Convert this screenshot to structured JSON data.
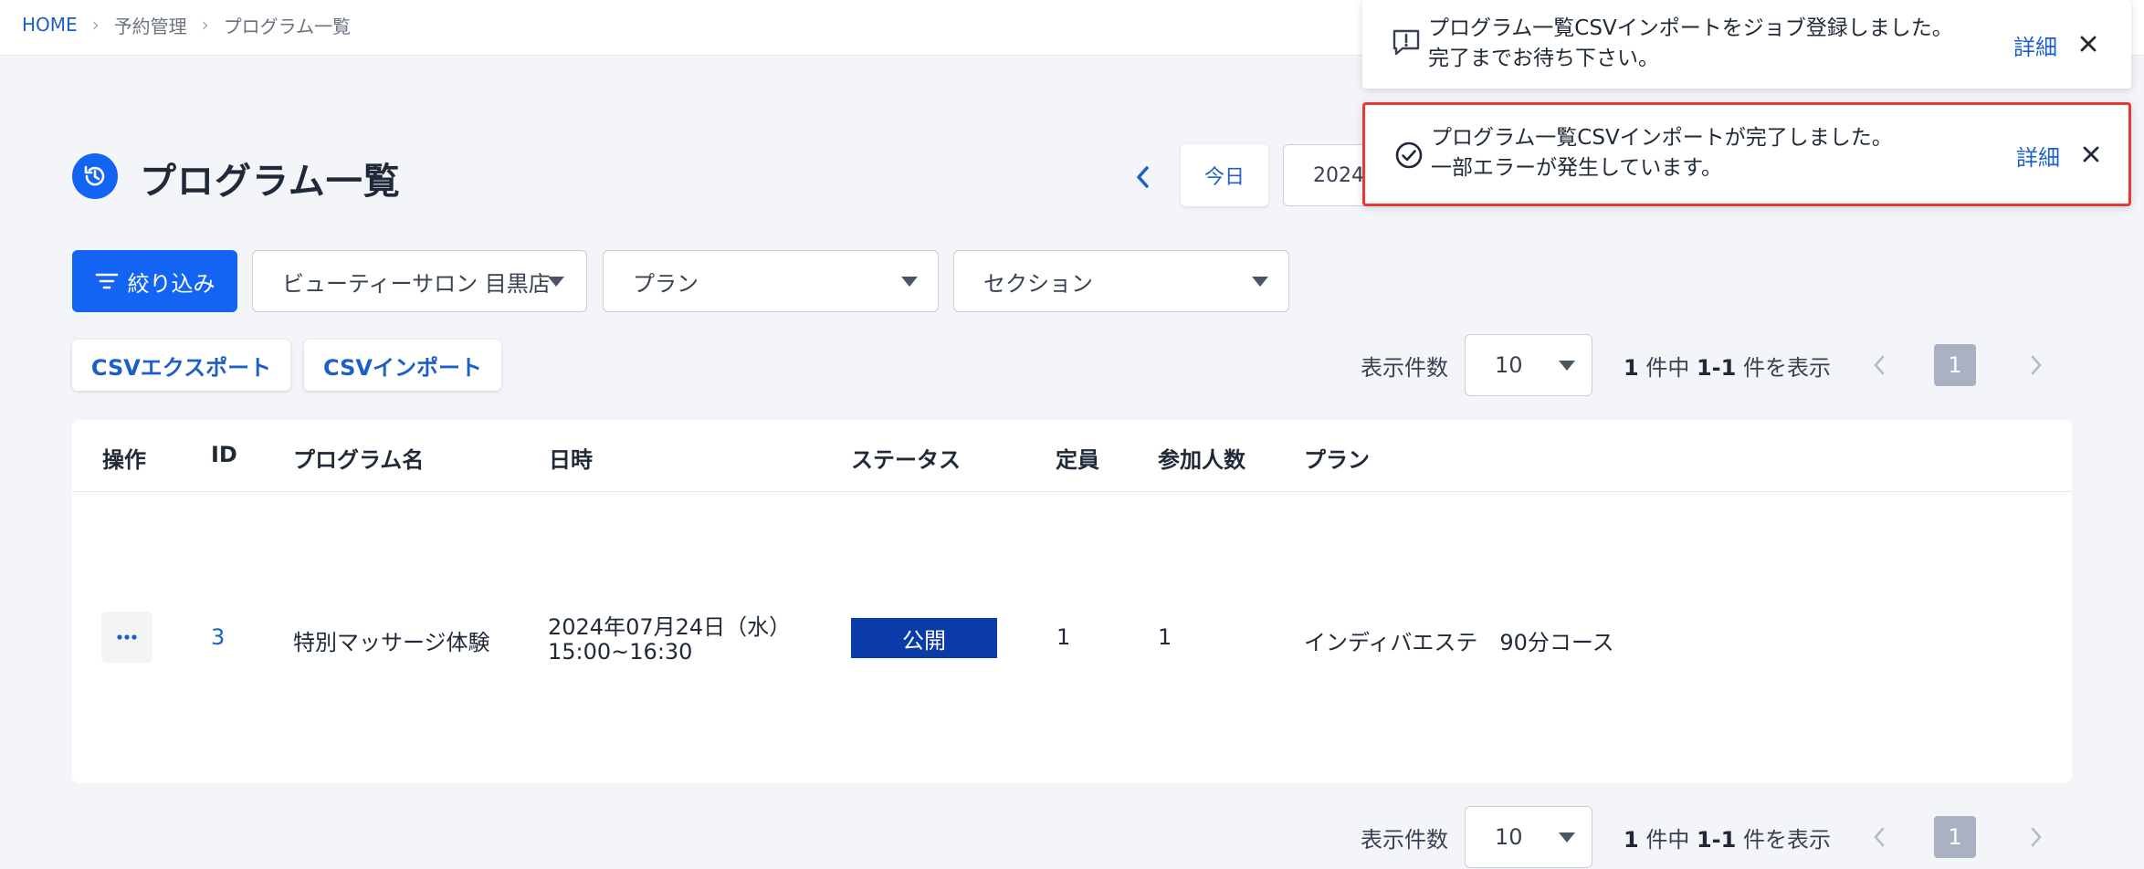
{
  "breadcrumb": {
    "home": "HOME",
    "level2": "予約管理",
    "level3": "プログラム一覧"
  },
  "page": {
    "title": "プログラム一覧"
  },
  "date_nav": {
    "today_label": "今日",
    "date_value": "2024"
  },
  "filters": {
    "filter_button": "絞り込み",
    "store_select": "ビューティーサロン 目黒店",
    "plan_select": "プラン",
    "section_select": "セクション"
  },
  "csv": {
    "export_label": "CSVエクスポート",
    "import_label": "CSVインポート"
  },
  "pagination": {
    "per_page_label": "表示件数",
    "per_page_value": "10",
    "total": "1",
    "unit_total": " 件中 ",
    "range": "1-1",
    "unit_range": " 件を表示",
    "current_page": "1"
  },
  "table": {
    "headers": {
      "action": "操作",
      "id": "ID",
      "name": "プログラム名",
      "datetime": "日時",
      "status": "ステータス",
      "capacity": "定員",
      "participants": "参加人数",
      "plan": "プラン"
    },
    "rows": [
      {
        "id": "3",
        "name": "特別マッサージ体験",
        "date": "2024年07月24日（水）",
        "time": "15:00~16:30",
        "status": "公開",
        "capacity": "1",
        "participants": "1",
        "plan": "インディバエステ　90分コース"
      }
    ]
  },
  "toasts": [
    {
      "line1": "プログラム一覧CSVインポートをジョブ登録しました。",
      "line2": "完了までお待ち下さい。",
      "detail": "詳細",
      "icon": "info-message-icon"
    },
    {
      "line1": "プログラム一覧CSVインポートが完了しました。",
      "line2": "一部エラーが発生しています。",
      "detail": "詳細",
      "icon": "check-circle-icon"
    }
  ],
  "colors": {
    "primary": "#1464f4",
    "link": "#1d5fc9",
    "status_public": "#0b3ba8",
    "highlight_border": "#e53935"
  }
}
